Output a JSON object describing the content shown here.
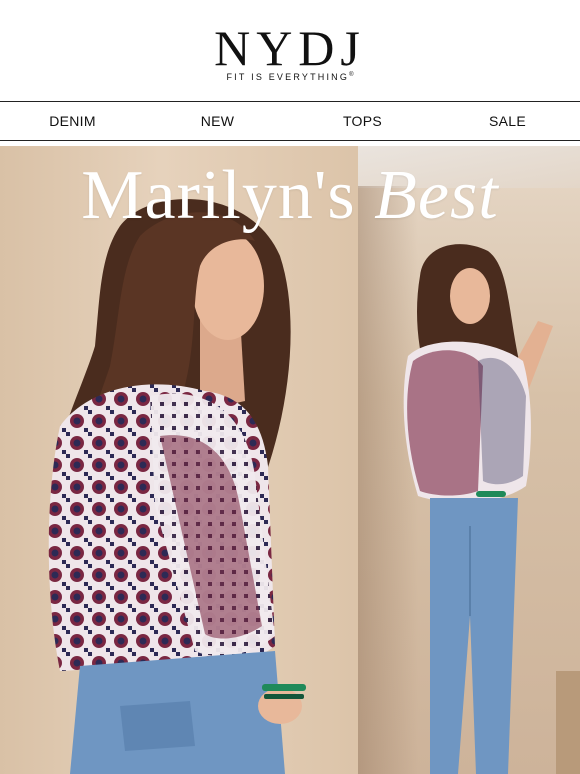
{
  "brand": {
    "logo_text": "NYDJ",
    "tagline": "FIT IS EVERYTHING",
    "tagline_mark": "®"
  },
  "nav": {
    "items": [
      "DENIM",
      "NEW",
      "TOPS",
      "SALE"
    ]
  },
  "hero": {
    "title_regular": "Marilyn's",
    "title_italic": "Best"
  },
  "colors": {
    "backdrop": "#e3cdb4",
    "hair": "#4a2c1e",
    "skin": "#e8b89a",
    "blouse_base": "#efe6ea",
    "blouse_pattern_burgundy": "#7a2742",
    "blouse_pattern_navy": "#2d2a55",
    "denim": "#6f96c2",
    "bracelet": "#1f8a5a"
  }
}
